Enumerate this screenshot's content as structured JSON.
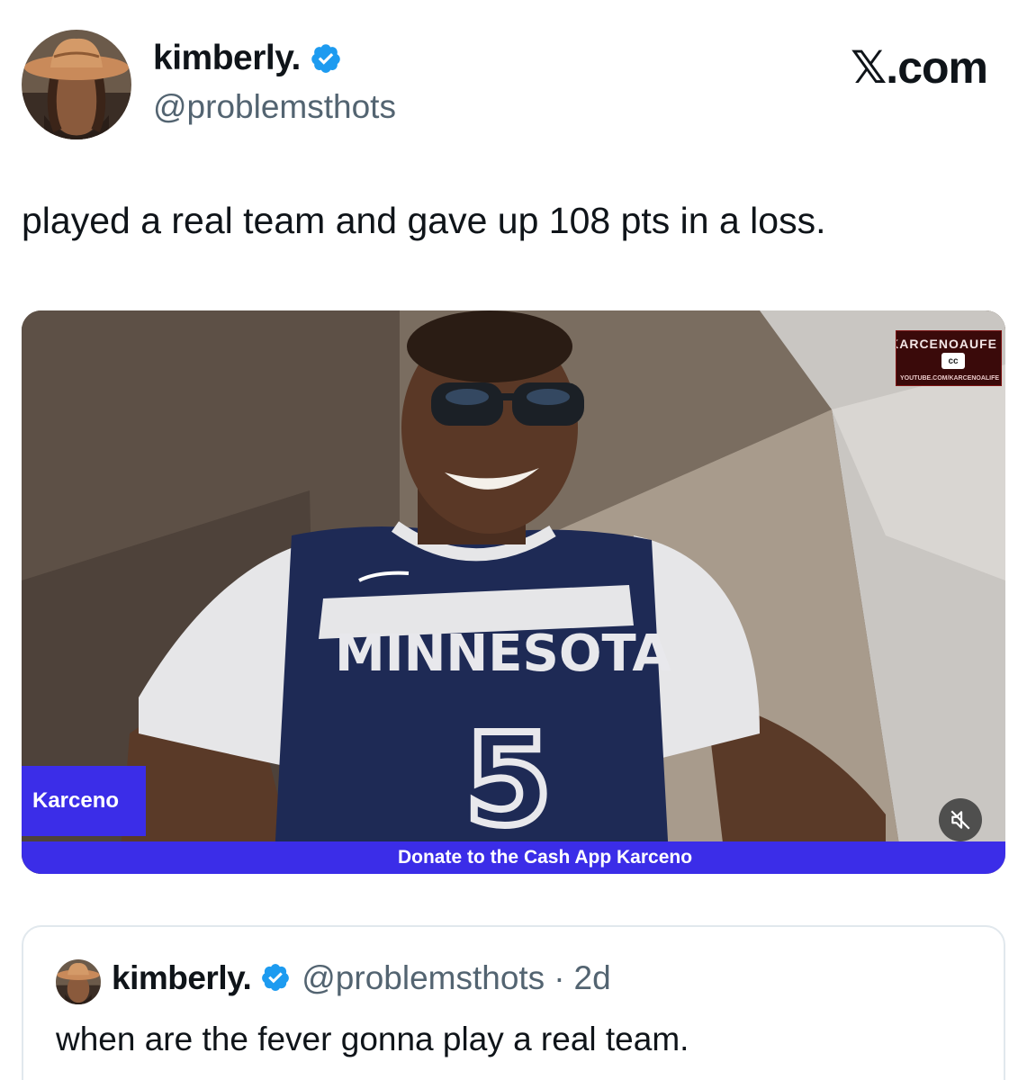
{
  "tweet": {
    "author": {
      "display_name": "kimberly.",
      "handle": "@problemsthots",
      "verified": true,
      "avatar_icon": "avatar-image"
    },
    "watermark": "𝕏.com",
    "text": "played a real team and gave up 108 pts in a loss."
  },
  "media": {
    "overlay_name": "Karceno",
    "bottom_banner": "Donate to the Cash App Karceno",
    "cc_label": "cc",
    "promo_title": "KARCENOAUFE",
    "promo_subtitle": "YOUTUBE.COM/KARCENOALIFE",
    "jersey_text": "MINNESOTA",
    "jersey_number": "5",
    "mute_icon": "muted-speaker-icon"
  },
  "quoted_tweet": {
    "display_name": "kimberly.",
    "handle": "@problemsthots",
    "separator": "·",
    "time": "2d",
    "text": "when are the fever gonna play a real team."
  },
  "colors": {
    "verified_blue": "#1d9bf0",
    "banner_blue": "#3b2de8",
    "secondary_text": "#536471",
    "jersey_navy": "#1e2a55"
  }
}
